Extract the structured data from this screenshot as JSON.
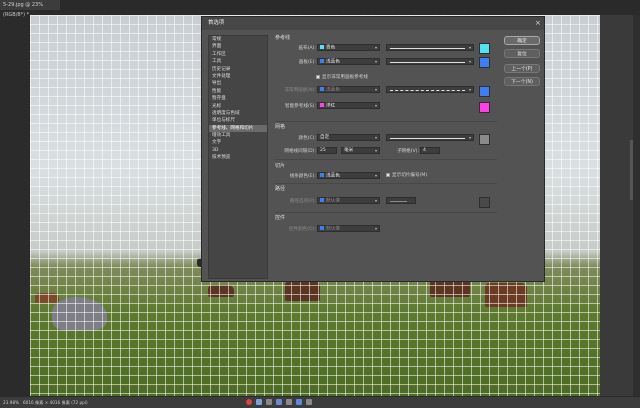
{
  "document": {
    "tab_title": "5-29.jpg @ 23%(RGB/8*) *"
  },
  "status": {
    "zoom": "23.98%",
    "doc_info": "6016 像素 × 4016 像素 (72 ppi)"
  },
  "dialog": {
    "title": "首选项",
    "close": "×",
    "sidebar": [
      "常规",
      "界面",
      "工作区",
      "工具",
      "历史记录",
      "文件处理",
      "导出",
      "性能",
      "暂存盘",
      "光标",
      "透明度与色域",
      "单位与标尺",
      "参考线、网格和切片",
      "增效工具",
      "文字",
      "3D",
      "技术预览"
    ],
    "selected_index": 12,
    "buttons": {
      "ok": "确定",
      "reset": "复位",
      "prev": "上一个(P)",
      "next": "下一个(N)"
    },
    "guides": {
      "heading": "参考线",
      "canvas_label": "画布(A):",
      "canvas_color": "青色",
      "canvas_hex": "#4fe3f3",
      "artboard_label": "画板(E):",
      "artboard_color": "浅蓝色",
      "artboard_hex": "#3f7df5",
      "show_artboard_guides": "显示非常用画板参考线",
      "overlay_label": "非常用画板(N):",
      "overlay_color": "浅蓝色",
      "overlay_hex": "#3f7df5",
      "smart_label": "智能参考线(S):",
      "smart_color": "洋红",
      "smart_hex": "#ff3fe7"
    },
    "grid": {
      "heading": "网格",
      "color_label": "颜色(C):",
      "color_value": "自定",
      "color_hex": "#8a8a8a",
      "spacing_label": "网格线间隔(D):",
      "spacing_value": "25",
      "unit": "毫米",
      "subdiv_label": "子网格(V):",
      "subdiv_value": "4"
    },
    "slices": {
      "heading": "切片",
      "color_label": "线条颜色(E):",
      "color_value": "浅蓝色",
      "color_hex": "#3f7df5",
      "show_numbers": "显示切片编号(M)"
    },
    "path": {
      "heading": "路径",
      "label": "路径选项(P):",
      "value": "默认值",
      "swatch_hex": "#3f7df5"
    },
    "controls": {
      "heading": "控件",
      "label": "控件颜色(O):",
      "value": "默认值",
      "swatch_hex": "#3f7df5"
    }
  },
  "colors": {
    "selected_row": "#6a6a6a",
    "dialog_bg": "#535353"
  }
}
